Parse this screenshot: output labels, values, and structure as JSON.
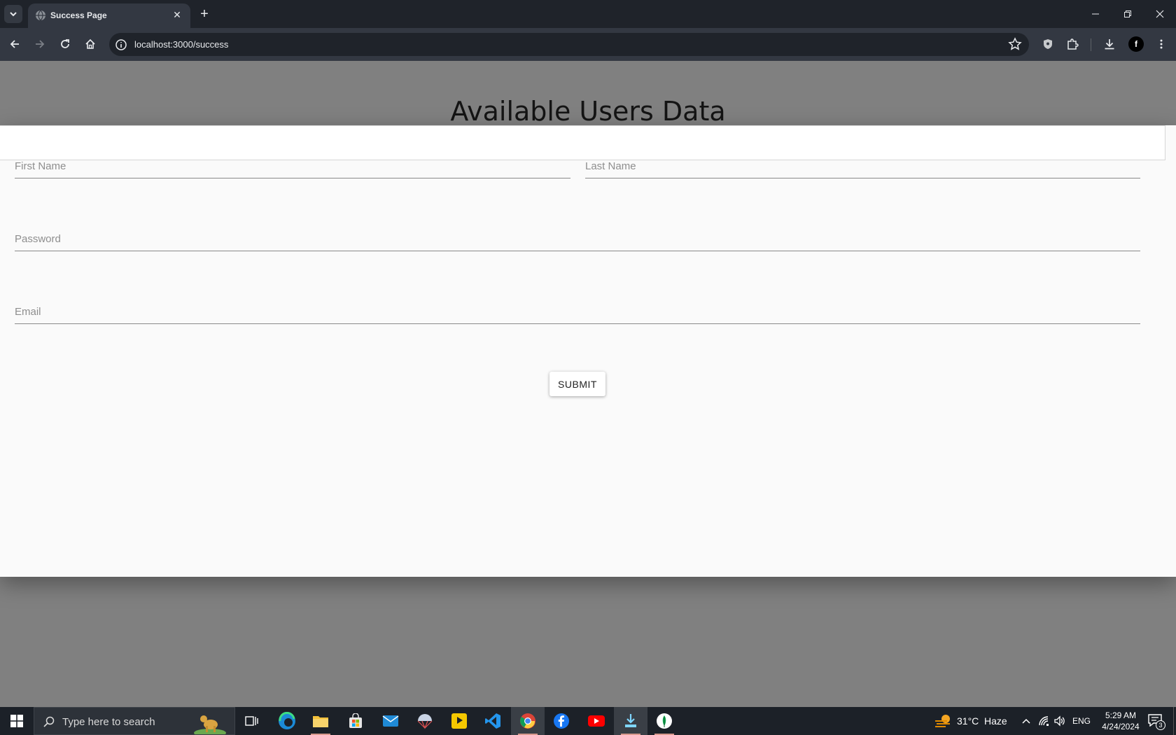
{
  "browser": {
    "tab_title": "Success Page",
    "url": "localhost:3000/success",
    "profile_initial": "f"
  },
  "page": {
    "heading": "Available Users Data",
    "form": {
      "first_name_placeholder": "First Name",
      "last_name_placeholder": "Last Name",
      "password_placeholder": "Password",
      "email_placeholder": "Email",
      "submit_label": "SUBMIT"
    }
  },
  "taskbar": {
    "search_placeholder": "Type here to search",
    "weather_temp": "31°C",
    "weather_desc": "Haze",
    "language": "ENG",
    "time": "5:29 AM",
    "date": "4/24/2024",
    "notification_count": "3"
  },
  "colors": {
    "chrome_dark": "#1f232a",
    "chrome_toolbar": "#333842",
    "backdrop": "#808080",
    "dialog_bg": "#fafafa"
  }
}
